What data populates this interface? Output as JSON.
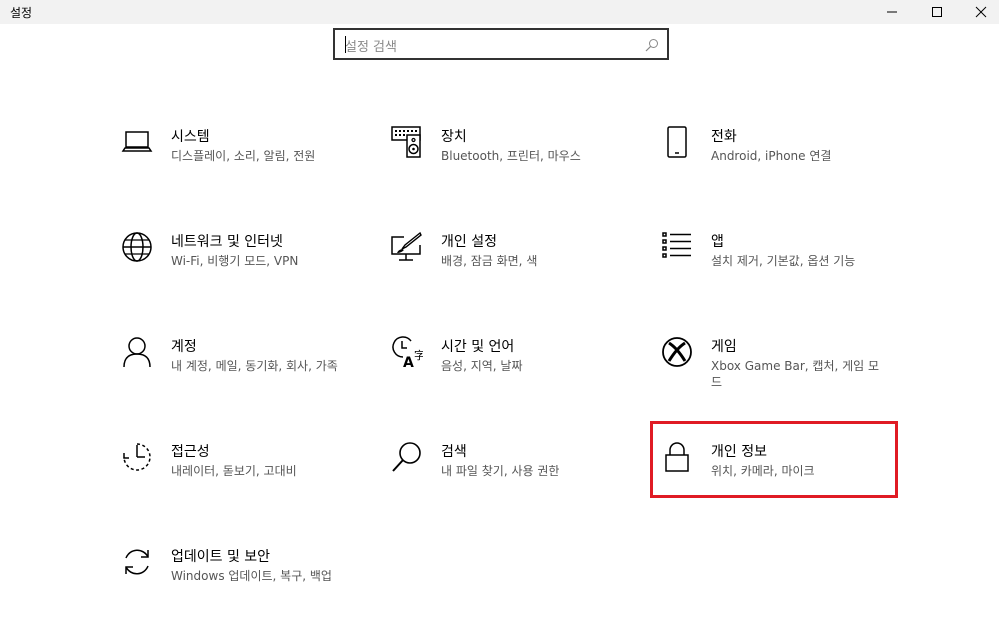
{
  "window": {
    "title": "설정",
    "controls": {
      "minimize": "minimize-icon",
      "maximize": "maximize-icon",
      "close": "close-icon"
    }
  },
  "search": {
    "placeholder": "설정 검색",
    "icon": "search-icon"
  },
  "tiles": [
    {
      "name": "시스템",
      "desc": "디스플레이, 소리, 알림, 전원",
      "icon": "laptop-icon"
    },
    {
      "name": "장치",
      "desc": "Bluetooth, 프린터, 마우스",
      "icon": "keyboard-speaker-icon"
    },
    {
      "name": "전화",
      "desc": "Android, iPhone 연결",
      "icon": "phone-icon"
    },
    {
      "name": "네트워크 및 인터넷",
      "desc": "Wi-Fi, 비행기 모드, VPN",
      "icon": "globe-icon"
    },
    {
      "name": "개인 설정",
      "desc": "배경, 잠금 화면, 색",
      "icon": "paintbrush-monitor-icon"
    },
    {
      "name": "앱",
      "desc": "설치 제거, 기본값, 옵션 기능",
      "icon": "app-list-icon"
    },
    {
      "name": "계정",
      "desc": "내 계정, 메일, 동기화, 회사, 가족",
      "icon": "person-icon"
    },
    {
      "name": "시간 및 언어",
      "desc": "음성, 지역, 날짜",
      "icon": "clock-language-icon"
    },
    {
      "name": "게임",
      "desc": "Xbox Game Bar, 캡처, 게임 모드",
      "icon": "xbox-icon"
    },
    {
      "name": "접근성",
      "desc": "내레이터, 돋보기, 고대비",
      "icon": "accessibility-timer-icon"
    },
    {
      "name": "검색",
      "desc": "내 파일 찾기, 사용 권한",
      "icon": "magnifier-icon"
    },
    {
      "name": "개인 정보",
      "desc": "위치, 카메라, 마이크",
      "icon": "lock-icon"
    },
    {
      "name": "업데이트 및 보안",
      "desc": "Windows 업데이트, 복구, 백업",
      "icon": "sync-icon"
    }
  ],
  "highlight": {
    "target": "개인 정보",
    "color": "#e01b24"
  }
}
